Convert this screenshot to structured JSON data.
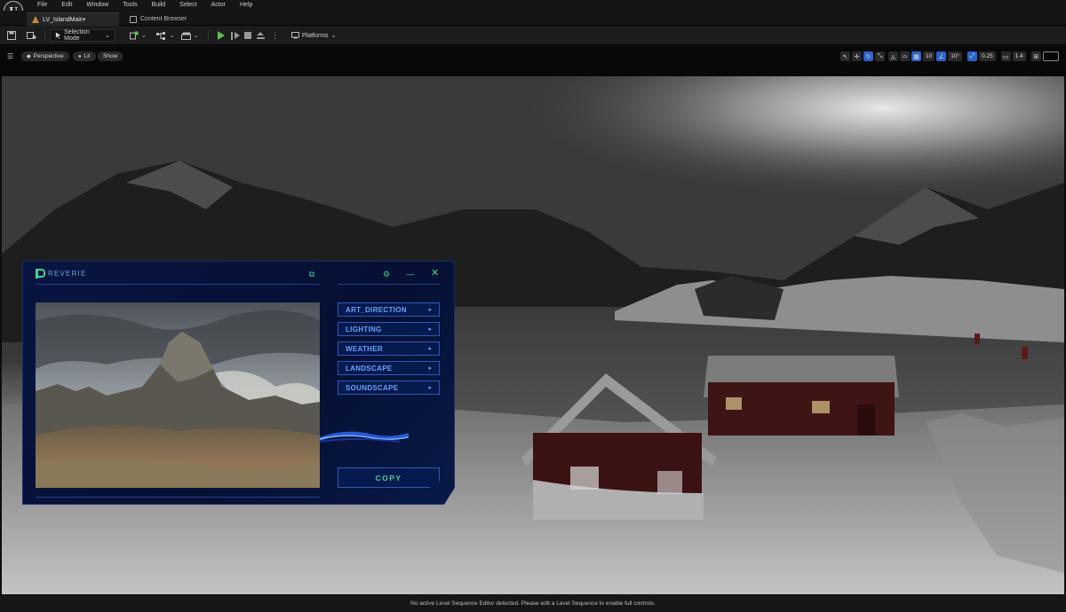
{
  "menu": {
    "items": [
      "File",
      "Edit",
      "Window",
      "Tools",
      "Build",
      "Select",
      "Actor",
      "Help"
    ]
  },
  "tabs": [
    {
      "label": "LV_IslandMain•",
      "icon": "level-icon"
    },
    {
      "label": "Content Browser",
      "icon": "content-browser-icon"
    }
  ],
  "toolbar": {
    "selection_mode": "Selection Mode",
    "platforms": "Platforms"
  },
  "viewport_toolbar": {
    "perspective": "Perspective",
    "lit": "Lit",
    "show": "Show",
    "grid_snap": "10",
    "rotation_snap": "10°",
    "scale_snap": "0.25",
    "camera_speed": "1.4"
  },
  "reverie": {
    "title": "REVERIE",
    "menu": [
      {
        "label": "ART_DIRECTION"
      },
      {
        "label": "LIGHTING"
      },
      {
        "label": "WEATHER"
      },
      {
        "label": "LANDSCAPE"
      },
      {
        "label": "SOUNDSCAPE"
      }
    ],
    "copy_label": "COPY",
    "accent_color": "#3fd68a",
    "menu_color": "#6aa0ff"
  },
  "status": {
    "message": "No active Level Sequence Editor detected. Please edit a Level Sequence to enable full controls."
  }
}
